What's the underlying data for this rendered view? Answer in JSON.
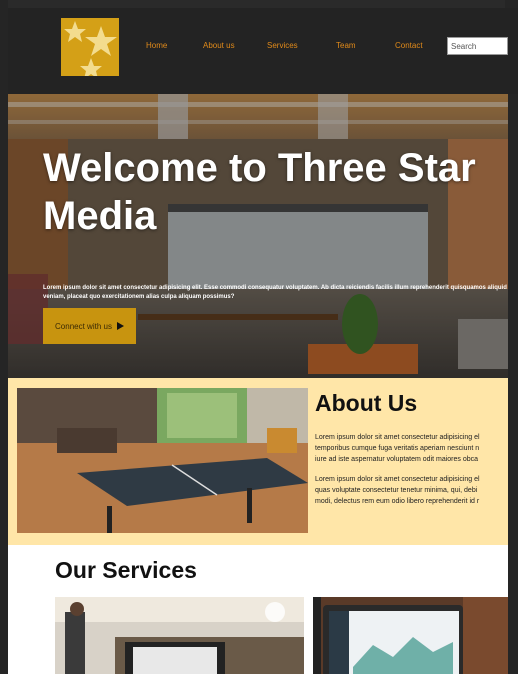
{
  "nav": {
    "links": [
      "Home",
      "About us",
      "Services",
      "Team",
      "Contact"
    ],
    "search_placeholder": "Search"
  },
  "hero": {
    "title": "Welcome to Three Star Media",
    "text": "Lorem ipsum dolor sit amet consectetur adipisicing elit. Esse commodi consequatur voluptatem. Ab dicta reiciendis facilis illum reprehenderit quisquamos aliquid veniam, placeat quo exercitationem alias culpa aliquam possimus?",
    "button_label": "Connect with us"
  },
  "about": {
    "title": "About Us",
    "para1": [
      "Lorem ipsum dolor sit amet consectetur adipisicing el",
      "temporibus cumque fuga veritatis aperiam nesciunt n",
      "iure ad iste aspernatur voluptatem odit maiores obca"
    ],
    "para2": [
      "Lorem ipsum dolor sit amet consectetur adipisicing el",
      "quas voluptate consectetur tenetur minima, qui, debi",
      "modi, delectus rem eum odio libero reprehenderit id r"
    ]
  },
  "services": {
    "title": "Our Services"
  },
  "colors": {
    "nav_bg": "#232323",
    "link": "#e08a1a",
    "logo": "#d4a017",
    "button": "#c8940f",
    "about_bg": "#ffe6a8"
  }
}
